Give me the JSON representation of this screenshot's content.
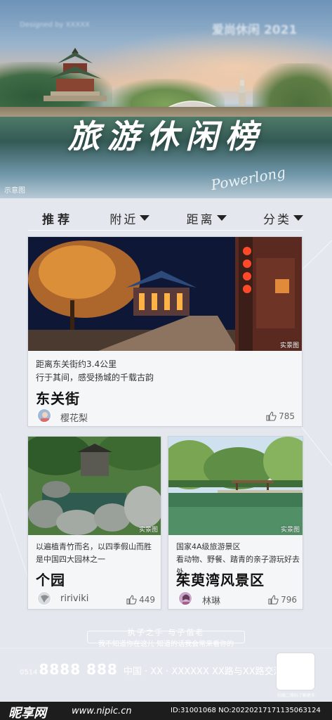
{
  "hero": {
    "watermark_left": "Designed by XXXXX",
    "watermark_right": "爱尚休闲 2021",
    "title": "旅游休闲榜",
    "signature": "Powerlong",
    "demo_note": "示意图"
  },
  "tabs": [
    {
      "label": "推荐"
    },
    {
      "label": "附近"
    },
    {
      "label": "距离"
    },
    {
      "label": "分类"
    }
  ],
  "cards": {
    "dongguan": {
      "photo_tag": "实景图",
      "desc_line1": "距离东关街约3.4公里",
      "desc_line2": "行于其间，感受扬城的千载古韵",
      "name": "东关街",
      "author": "樱花梨",
      "likes": "785"
    },
    "geyuan": {
      "photo_tag": "实景图",
      "desc_line1": "以遍植青竹而名，以四季假山而胜",
      "desc_line2": "是中国四大园林之一",
      "name": "个园",
      "author": "ririviki",
      "likes": "449"
    },
    "zhuyu": {
      "photo_tag": "实景图",
      "desc_line1": "国家4A级旅游景区",
      "desc_line2": "看动物、野餐、踏青的亲子游玩好去处",
      "name": "茱萸湾风景区",
      "author": "林琳",
      "likes": "796"
    }
  },
  "footer": {
    "slogan": "执子之手 与子偕老",
    "slogan_sub": "我不知道你在这儿 知道的话我会常来看你的",
    "phone_prefix": "0514",
    "phone": "8888 888",
    "address": "中国 · XX · XXXXXX  XX路与XX路交汇处",
    "qr_label": "扫描二维码了解更多"
  },
  "credit": {
    "logo": "昵享网",
    "url": "www.nipic.cn",
    "id_text": "ID:31001068 NO:20220217171135063124"
  },
  "colors": {
    "page_bg": "#e4e8ee",
    "card_bg": "#f5f6f8",
    "credit_bar": "#1d1d1d"
  }
}
